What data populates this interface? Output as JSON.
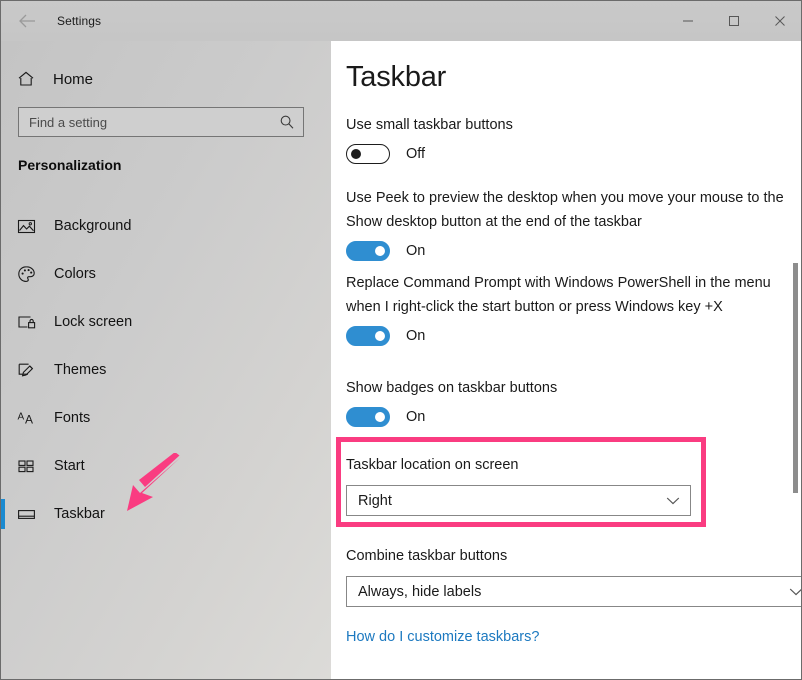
{
  "window": {
    "title": "Settings",
    "back_icon": "back-arrow-icon",
    "minimize_label": "Minimize",
    "maximize_label": "Maximize",
    "close_label": "Close"
  },
  "sidebar": {
    "home": {
      "label": "Home",
      "icon": "home-icon"
    },
    "search": {
      "placeholder": "Find a setting",
      "value": "",
      "icon": "search-icon"
    },
    "section_heading": "Personalization",
    "items": [
      {
        "label": "Background",
        "icon": "picture-icon",
        "selected": false
      },
      {
        "label": "Colors",
        "icon": "palette-icon",
        "selected": false
      },
      {
        "label": "Lock screen",
        "icon": "lock-screen-icon",
        "selected": false
      },
      {
        "label": "Themes",
        "icon": "paintbrush-icon",
        "selected": false
      },
      {
        "label": "Fonts",
        "icon": "fonts-aa-icon",
        "selected": false
      },
      {
        "label": "Start",
        "icon": "start-tiles-icon",
        "selected": false
      },
      {
        "label": "Taskbar",
        "icon": "taskbar-icon",
        "selected": true
      }
    ]
  },
  "main": {
    "title": "Taskbar",
    "settings": [
      {
        "label": "Use small taskbar buttons",
        "type": "toggle",
        "state": "Off",
        "on": false
      },
      {
        "label": "Use Peek to preview the desktop when you move your mouse to the Show desktop button at the end of the taskbar",
        "type": "toggle",
        "state": "On",
        "on": true
      },
      {
        "label": "Replace Command Prompt with Windows PowerShell in the menu when I right-click the start button or press Windows key +X",
        "type": "toggle",
        "state": "On",
        "on": true
      },
      {
        "label": "Show badges on taskbar buttons",
        "type": "toggle",
        "state": "On",
        "on": true
      },
      {
        "label": "Taskbar location on screen",
        "type": "dropdown",
        "value": "Right",
        "highlighted": true
      },
      {
        "label": "Combine taskbar buttons",
        "type": "dropdown",
        "value": "Always, hide labels",
        "highlighted": false
      }
    ],
    "help_link": "How do I customize taskbars?"
  },
  "annotations": {
    "highlight_color": "#fa3c81",
    "arrow_color": "#fa3c81",
    "arrow_target": "sidebar-item-taskbar"
  },
  "colors": {
    "accent_blue": "#2f8ed1",
    "selection_blue": "#1b8ad0",
    "link_blue": "#1c79c0",
    "sidebar_gray": "#cbcbcb"
  }
}
